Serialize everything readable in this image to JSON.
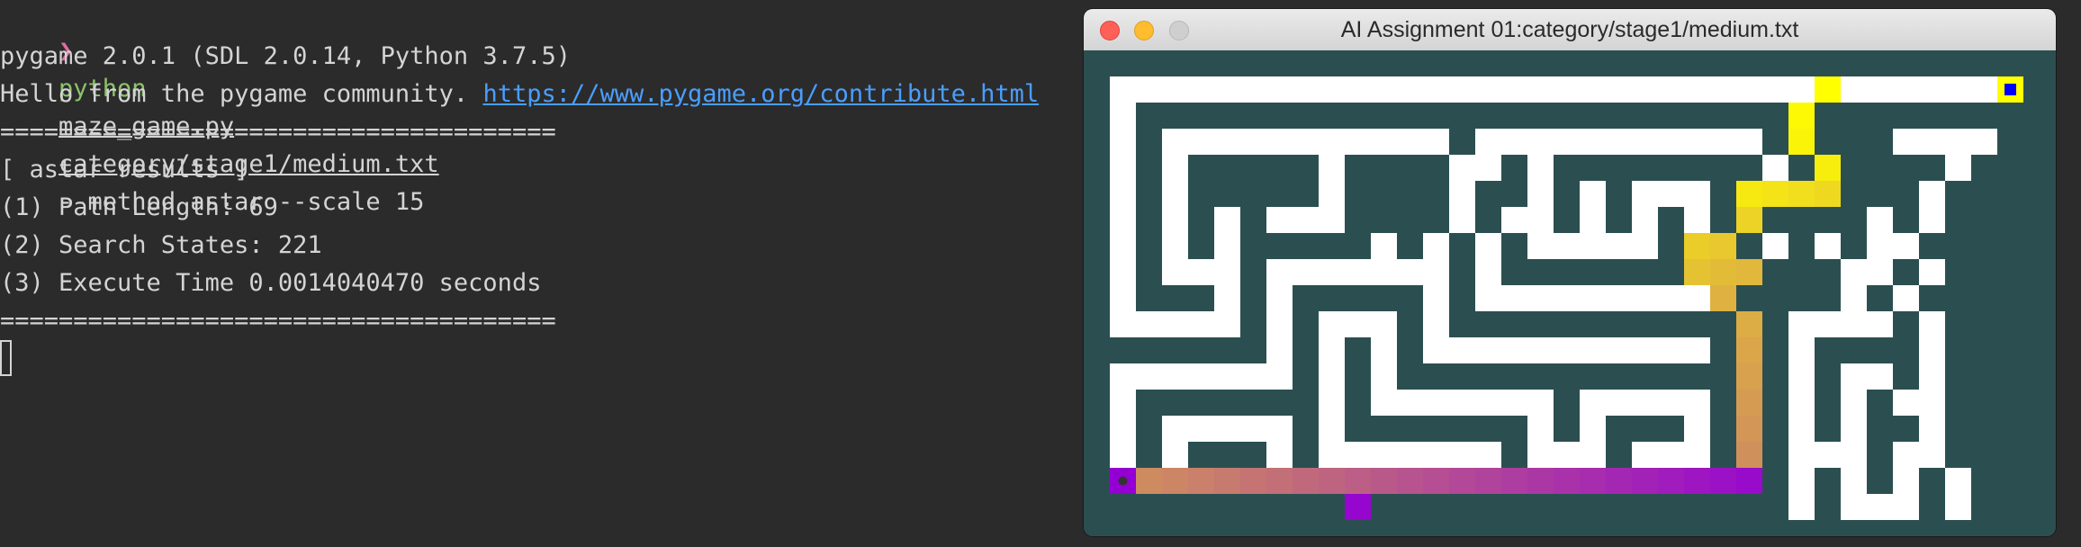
{
  "terminal": {
    "prompt_symbol": "❯",
    "command": "python",
    "script": "maze_game.py",
    "maze_file": "category/stage1/medium.txt",
    "options": "--method astar --scale 15",
    "line_pygame": "pygame 2.0.1 (SDL 2.0.14, Python 3.7.5)",
    "line_hello": "Hello from the pygame community. ",
    "link": "https://www.pygame.org/contribute.html",
    "separator": "======================================",
    "results_header": "[ astar results ]",
    "path_length": "(1) Path Length: 69",
    "search_states": "(2) Search States: 221",
    "execute_time": "(3) Execute Time 0.0014040470 seconds",
    "separator2": "======================================"
  },
  "window": {
    "title": "AI Assignment 01:category/stage1/medium.txt"
  },
  "maze": {
    "colors": {
      "wall": "#2b4f50",
      "open": "#ffffff",
      "goal": "#0000ff",
      "start": "#333333",
      "path_start": "#ffff00",
      "path_end": "#9400d3"
    },
    "grid": [
      "#####################################",
      "#...........................P......G#",
      "#.#########################P########",
      "#.#...........#...........#P###....#",
      "#.#.#####.####..#.########.#P####.#",
      "#.#.#####.####.##.#.#...#PPPP###.#",
      "#.#.#.#...####.#..#.#.#.#P####.#.#",
      "#.#.#.#####.#.#.#.....#PP#.#.#..#",
      "#.#...#.......#.#######PPP###..#.#",
      "#.###.#.#####.#.........P####.#.#",
      "#.....#.#...#.###########P#....#.#",
      "#######.#.#.#...........#P#.####.#",
      "#.......#.#.#############P#.#..#.#",
      "#.#######.#.......#.....#P#.#.#..#",
      "#.#.....#.#######.#.###.#P#.#.##.#",
      "#.#.###.#.......#...#...#P#...#..#",
      "#SPPPPPPPPPPPPPPPPPPPPPPPP#.#.#.#.#",
      "##########P################.#...#.#"
    ]
  }
}
